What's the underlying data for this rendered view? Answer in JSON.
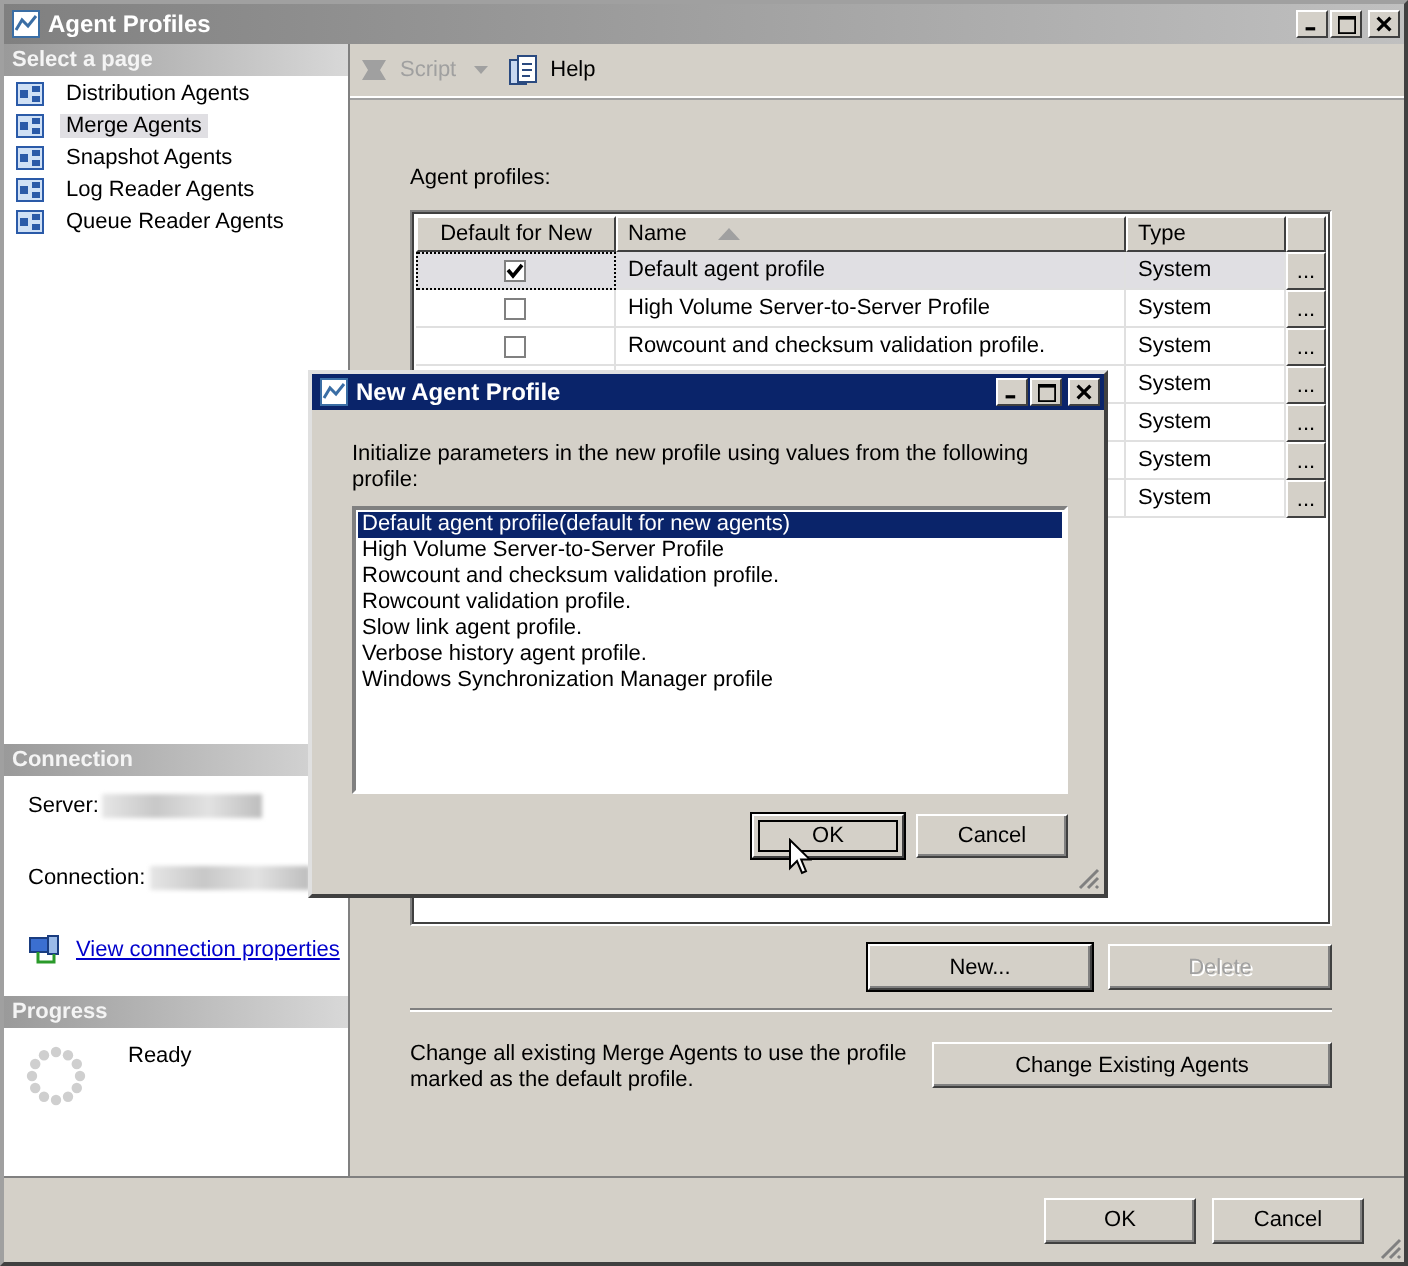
{
  "window": {
    "title": "Agent Profiles"
  },
  "sidebar": {
    "header": "Select a page",
    "items": [
      {
        "label": "Distribution Agents",
        "selected": false
      },
      {
        "label": "Merge Agents",
        "selected": true
      },
      {
        "label": "Snapshot Agents",
        "selected": false
      },
      {
        "label": "Log Reader Agents",
        "selected": false
      },
      {
        "label": "Queue Reader Agents",
        "selected": false
      }
    ]
  },
  "connection": {
    "header": "Connection",
    "fields": [
      {
        "label": "Server:"
      },
      {
        "label": "Connection:"
      }
    ],
    "link": "View connection properties"
  },
  "progress": {
    "header": "Progress",
    "status": "Ready"
  },
  "toolbar": [
    {
      "kind": "script",
      "label": "Script",
      "disabled": true
    },
    {
      "kind": "help",
      "label": "Help",
      "disabled": false
    }
  ],
  "main": {
    "label": "Agent profiles:",
    "columns": [
      {
        "label": "Default for New",
        "sorted": false
      },
      {
        "label": "Name",
        "sorted": true
      },
      {
        "label": "Type",
        "sorted": false
      }
    ],
    "rows": [
      {
        "default": true,
        "selected": true,
        "name": "Default agent profile",
        "type": "System",
        "button": "..."
      },
      {
        "default": false,
        "selected": false,
        "name": "High Volume Server-to-Server Profile",
        "type": "System",
        "button": "..."
      },
      {
        "default": false,
        "selected": false,
        "name": "Rowcount and checksum validation profile.",
        "type": "System",
        "button": "..."
      },
      {
        "type": "System",
        "button": "..."
      },
      {
        "type": "System",
        "button": "..."
      },
      {
        "type": "System",
        "button": "..."
      },
      {
        "type": "System",
        "button": "..."
      }
    ],
    "buttons": [
      {
        "label": "New...",
        "disabled": false,
        "default": true
      },
      {
        "label": "Delete",
        "disabled": true,
        "default": false
      }
    ],
    "change_text": "Change all existing Merge Agents to use the profile marked as the default profile.",
    "change_button": "Change Existing Agents"
  },
  "footer": [
    {
      "label": "OK"
    },
    {
      "label": "Cancel"
    }
  ],
  "dialog": {
    "title": "New Agent Profile",
    "prompt": "Initialize parameters in the new profile using values from the following profile:",
    "options": [
      {
        "label": "Default agent profile(default for new agents)",
        "selected": true
      },
      {
        "label": "High Volume Server-to-Server Profile",
        "selected": false
      },
      {
        "label": "Rowcount and checksum validation profile.",
        "selected": false
      },
      {
        "label": "Rowcount validation profile.",
        "selected": false
      },
      {
        "label": "Slow link agent profile.",
        "selected": false
      },
      {
        "label": "Verbose history agent profile.",
        "selected": false
      },
      {
        "label": "Windows Synchronization Manager profile",
        "selected": false
      }
    ],
    "buttons": [
      {
        "label": "OK",
        "focused": true
      },
      {
        "label": "Cancel",
        "focused": false
      }
    ]
  }
}
